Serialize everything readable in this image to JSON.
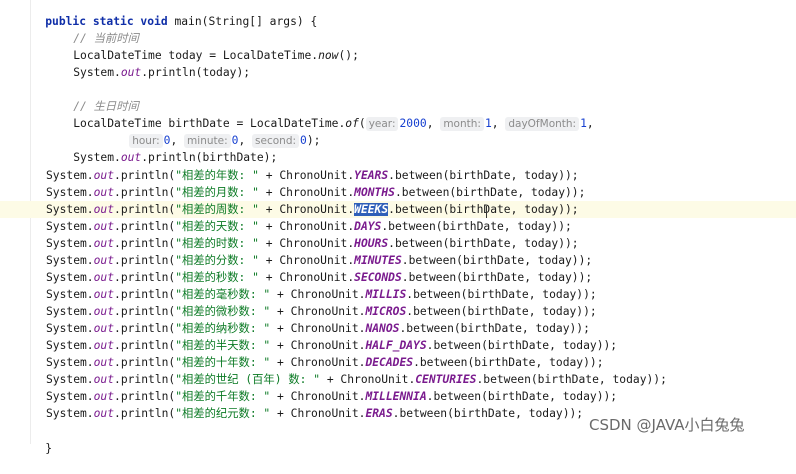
{
  "code": {
    "signature": {
      "kw": "public static void",
      "rest": " main(String[] args) {"
    },
    "comment_now": "// 当前时间",
    "today_decl": {
      "a": "LocalDateTime today = LocalDateTime.",
      "method": "now",
      "b": "();"
    },
    "println_today": {
      "a": "System.",
      "out": "out",
      "b": ".println(today);"
    },
    "comment_birth": "// 生日时间",
    "birth_decl": {
      "a": "LocalDateTime birthDate = LocalDateTime.",
      "method": "of",
      "b": "(",
      "hint_year": "year:",
      "year": "2000",
      "hint_month": "month:",
      "month": "1",
      "hint_day": "dayOfMonth:",
      "day": "1",
      "comma": ",",
      "sep": ", "
    },
    "birth_decl2": {
      "hint_hour": "hour:",
      "hour": "0",
      "hint_minute": "minute:",
      "minute": "0",
      "hint_second": "second:",
      "second": "0",
      "end": ");",
      "sep": ", "
    },
    "println_birth": {
      "a": "System.",
      "out": "out",
      "b": ".println(birthDate);"
    },
    "println_rows": [
      {
        "label": "\"相差的年数: \"",
        "unit": "YEARS"
      },
      {
        "label": "\"相差的月数: \"",
        "unit": "MONTHS"
      },
      {
        "label": "\"相差的周数: \"",
        "unit": "WEEKS"
      },
      {
        "label": "\"相差的天数: \"",
        "unit": "DAYS"
      },
      {
        "label": "\"相差的时数: \"",
        "unit": "HOURS"
      },
      {
        "label": "\"相差的分数: \"",
        "unit": "MINUTES"
      },
      {
        "label": "\"相差的秒数: \"",
        "unit": "SECONDS"
      },
      {
        "label": "\"相差的毫秒数: \"",
        "unit": "MILLIS"
      },
      {
        "label": "\"相差的微秒数: \"",
        "unit": "MICROS"
      },
      {
        "label": "\"相差的纳秒数: \"",
        "unit": "NANOS"
      },
      {
        "label": "\"相差的半天数: \"",
        "unit": "HALF_DAYS"
      },
      {
        "label": "\"相差的十年数: \"",
        "unit": "DECADES"
      },
      {
        "label": "\"相差的世纪 (百年) 数: \"",
        "unit": "CENTURIES"
      },
      {
        "label": "\"相差的千年数: \"",
        "unit": "MILLENNIA"
      },
      {
        "label": "\"相差的纪元数: \"",
        "unit": "ERAS"
      }
    ],
    "row_parts": {
      "sys": "System.",
      "out": "out",
      "println_open": ".println(",
      "plus": " + ChronoUnit.",
      "between": ".between(birthDate, today));"
    },
    "closing_brace": "}"
  },
  "watermark": "CSDN @JAVA小白兔兔",
  "colors": {
    "keyword": "#0f2ea8",
    "string": "#0b7a24",
    "number": "#1740d0",
    "field": "#7a1b8e",
    "comment": "#8a8a8a",
    "selection": "#2f5fb8",
    "breakpoint_marker": "#f3b521"
  }
}
